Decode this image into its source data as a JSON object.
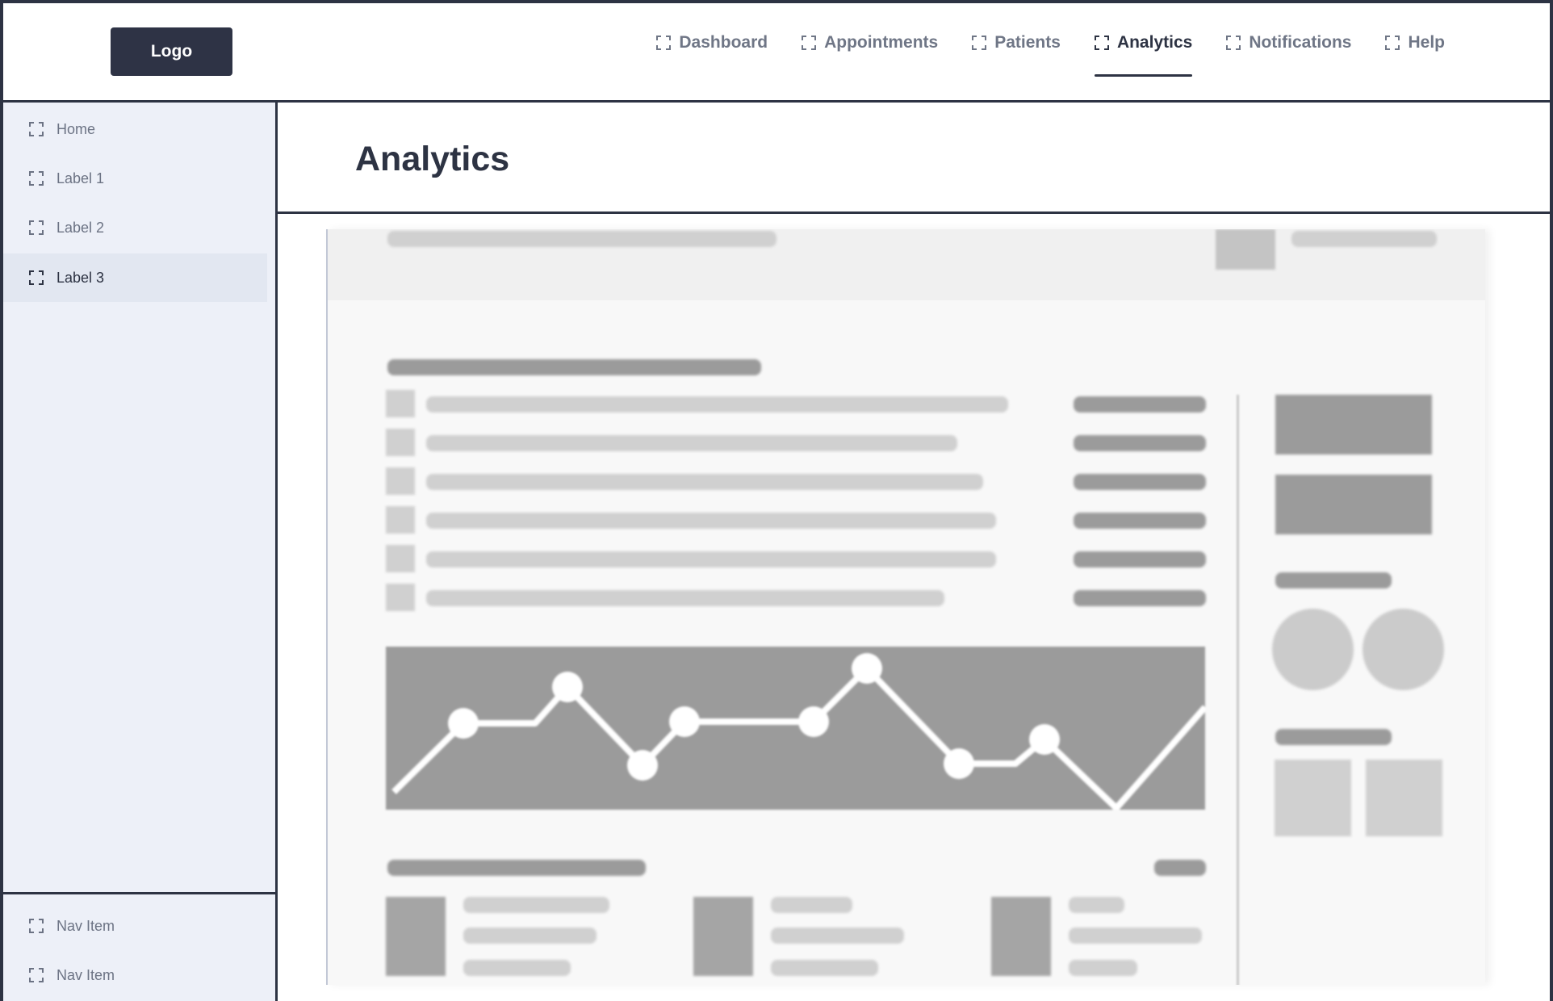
{
  "header": {
    "logo_label": "Logo",
    "nav": [
      {
        "label": "Dashboard",
        "icon": "frame-corners-icon",
        "active": false
      },
      {
        "label": "Appointments",
        "icon": "frame-corners-icon",
        "active": false
      },
      {
        "label": "Patients",
        "icon": "frame-corners-icon",
        "active": false
      },
      {
        "label": "Analytics",
        "icon": "frame-corners-icon",
        "active": true
      },
      {
        "label": "Notifications",
        "icon": "frame-corners-icon",
        "active": false
      },
      {
        "label": "Help",
        "icon": "frame-corners-icon",
        "active": false
      }
    ]
  },
  "sidebar": {
    "items": [
      {
        "label": "Home",
        "icon": "frame-corners-icon",
        "active": false
      },
      {
        "label": "Label 1",
        "icon": "frame-corners-icon",
        "active": false
      },
      {
        "label": "Label 2",
        "icon": "frame-corners-icon",
        "active": false
      },
      {
        "label": "Label 3",
        "icon": "frame-corners-icon",
        "active": true
      }
    ],
    "footer_items": [
      {
        "label": "Nav Item",
        "icon": "frame-corners-icon"
      },
      {
        "label": "Nav Item",
        "icon": "frame-corners-icon"
      }
    ]
  },
  "main": {
    "title": "Analytics"
  },
  "colors": {
    "accent": "#2d3343",
    "sidebar_bg": "#edf0f8",
    "sidebar_active_bg": "#e2e7f1",
    "muted_text": "#6f7686",
    "placeholder_dark": "#9b9b9b",
    "placeholder_light": "#d0d0d0"
  }
}
